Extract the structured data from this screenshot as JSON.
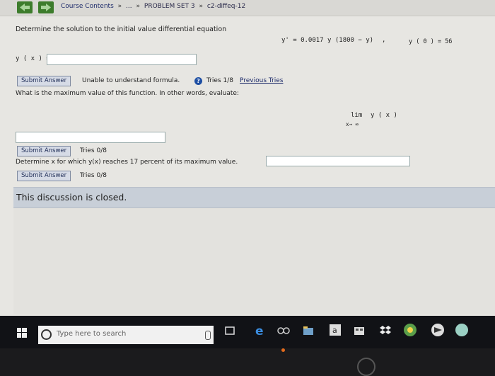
{
  "breadcrumb": {
    "items": [
      "Course Contents",
      "...",
      "PROBLEM SET 3",
      "c2-diffeq-12"
    ],
    "separator": "»"
  },
  "problem": {
    "prompt": "Determine the solution to the initial value differential equation",
    "equation": "y' = 0.0017 y (1800 − y)",
    "comma": ",",
    "initial_condition": "y ( 0 ) = 56",
    "answer_label": "y ( x ) =",
    "answer_value": ""
  },
  "part1": {
    "submit_label": "Submit Answer",
    "status": "Unable to understand formula.",
    "help_icon": "?",
    "tries": "Tries 1/8",
    "previous_tries": "Previous Tries"
  },
  "part2": {
    "question": "What is the maximum value of this function. In other words, evaluate:",
    "limit_word": "lim",
    "limit_sub": "x→ ∞",
    "limit_expr": "y ( x )",
    "answer_value": "",
    "submit_label": "Submit Answer",
    "tries": "Tries 0/8"
  },
  "part3": {
    "question": "Determine x for which y(x) reaches 17 percent of its maximum value.",
    "answer_value": "",
    "submit_label": "Submit Answer",
    "tries": "Tries 0/8"
  },
  "discussion": {
    "closed_text": "This discussion is closed."
  },
  "taskbar": {
    "search_placeholder": "Type here to search",
    "icons": [
      "windows-start-icon",
      "microphone-icon",
      "task-view-icon",
      "edge-icon",
      "people-icon",
      "file-explorer-icon",
      "amazon-icon",
      "store-icon",
      "dropbox-icon",
      "chrome-icon",
      "app-icon",
      "app-icon"
    ]
  },
  "device": {
    "logo": "hp"
  },
  "colors": {
    "nav_green": "#3d7c2c",
    "button_fill": "#d6dbe6",
    "closed_bar": "#c8cfd8",
    "taskbar": "#111216"
  }
}
